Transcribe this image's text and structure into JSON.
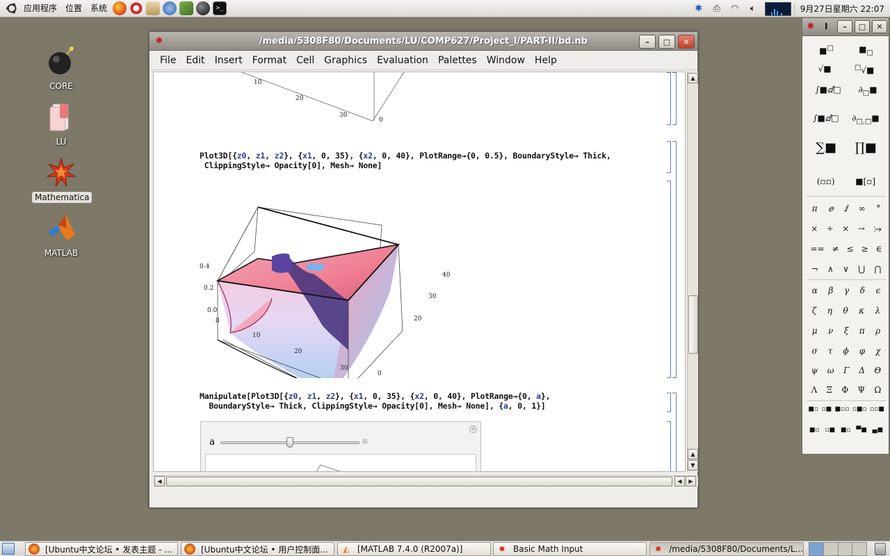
{
  "top_panel": {
    "menus": [
      "应用程序",
      "位置",
      "系统"
    ],
    "clock": "9月27日星期六 22:07"
  },
  "desktop": {
    "icons": [
      {
        "label": "CORE",
        "icon": "bomb-icon"
      },
      {
        "label": "LU",
        "icon": "folder-icon"
      },
      {
        "label": "Mathematica",
        "icon": "mathematica-icon",
        "selected": true
      },
      {
        "label": "MATLAB",
        "icon": "matlab-icon"
      }
    ]
  },
  "notebook": {
    "title": "/media/5308F80/Documents/LU/COMP627/Project_I/PART-II/bd.nb",
    "menu": [
      "File",
      "Edit",
      "Insert",
      "Format",
      "Cell",
      "Graphics",
      "Evaluation",
      "Palettes",
      "Window",
      "Help"
    ],
    "cell1_ticks": [
      "10",
      "20",
      "30",
      "0"
    ],
    "plot3d_code": {
      "prefix": "Plot3D[{",
      "v1": "z0",
      "v2": "z1",
      "v3": "z2",
      "mid1": "}, {",
      "v4": "x1",
      "mid2": ", 0, 35}, {",
      "v5": "x2",
      "mid3": ", 0, 40}, PlotRange→{0, 0.5}, BoundaryStyle→ Thick,",
      "line2": " ClippingStyle→ Opacity[0], Mesh→ None]"
    },
    "plot_ticks": {
      "z": [
        "0.4",
        "0.2",
        "0.0"
      ],
      "x": [
        "0",
        "10",
        "20",
        "30",
        "0"
      ],
      "y": [
        "40",
        "30",
        "20",
        "10"
      ]
    },
    "manipulate_code": {
      "prefix": "Manipulate[Plot3D[{",
      "v1": "z0",
      "v2": "z1",
      "v3": "z2",
      "mid1": "}, {",
      "v4": "x1",
      "mid2": ", 0, 35}, {",
      "v5": "x2",
      "mid3": ", 0, 40}, PlotRange→{0, ",
      "v6": "a",
      "end1": "},",
      "line2a": "  BoundaryStyle→ Thick, ClippingStyle→ Opacity[0], Mesh→ None], {",
      "v7": "a",
      "line2b": ", 0, 1}]"
    },
    "manipulate": {
      "slider_label": "a",
      "slider_value": 0.5
    }
  },
  "palette": {
    "title_text": "I",
    "rows_greek1": [
      "π",
      "ⅇ",
      "ⅈ",
      "∞",
      "°"
    ],
    "rows_ops1": [
      "×",
      "÷",
      "×",
      "→",
      "⧴"
    ],
    "rows_ops2": [
      "==",
      "≠",
      "≤",
      "≥",
      "∈"
    ],
    "rows_ops3": [
      "¬",
      "∧",
      "∨",
      "⋃",
      "⋂"
    ],
    "greek_rows": [
      [
        "α",
        "β",
        "γ",
        "δ",
        "ϵ"
      ],
      [
        "ζ",
        "η",
        "θ",
        "κ",
        "λ"
      ],
      [
        "μ",
        "ν",
        "ξ",
        "π",
        "ρ"
      ],
      [
        "σ",
        "τ",
        "ϕ",
        "φ",
        "χ"
      ],
      [
        "ψ",
        "ω",
        "Γ",
        "Δ",
        "Θ"
      ],
      [
        "Λ",
        "Ξ",
        "Φ",
        "Ψ",
        "Ω"
      ]
    ]
  },
  "taskbar": {
    "tasks": [
      {
        "label": "[Ubuntu中文论坛 • 发表主题 - ...",
        "icon": "firefox-icon"
      },
      {
        "label": "[Ubuntu中文论坛 • 用户控制面...",
        "icon": "firefox-icon"
      },
      {
        "label": "[MATLAB  7.4.0 (R2007a)]",
        "icon": "matlab-icon"
      },
      {
        "label": "Basic Math Input",
        "icon": "mathematica-icon"
      },
      {
        "label": "/media/5308F80/Documents/L...",
        "icon": "mathematica-icon",
        "active": true
      }
    ]
  }
}
